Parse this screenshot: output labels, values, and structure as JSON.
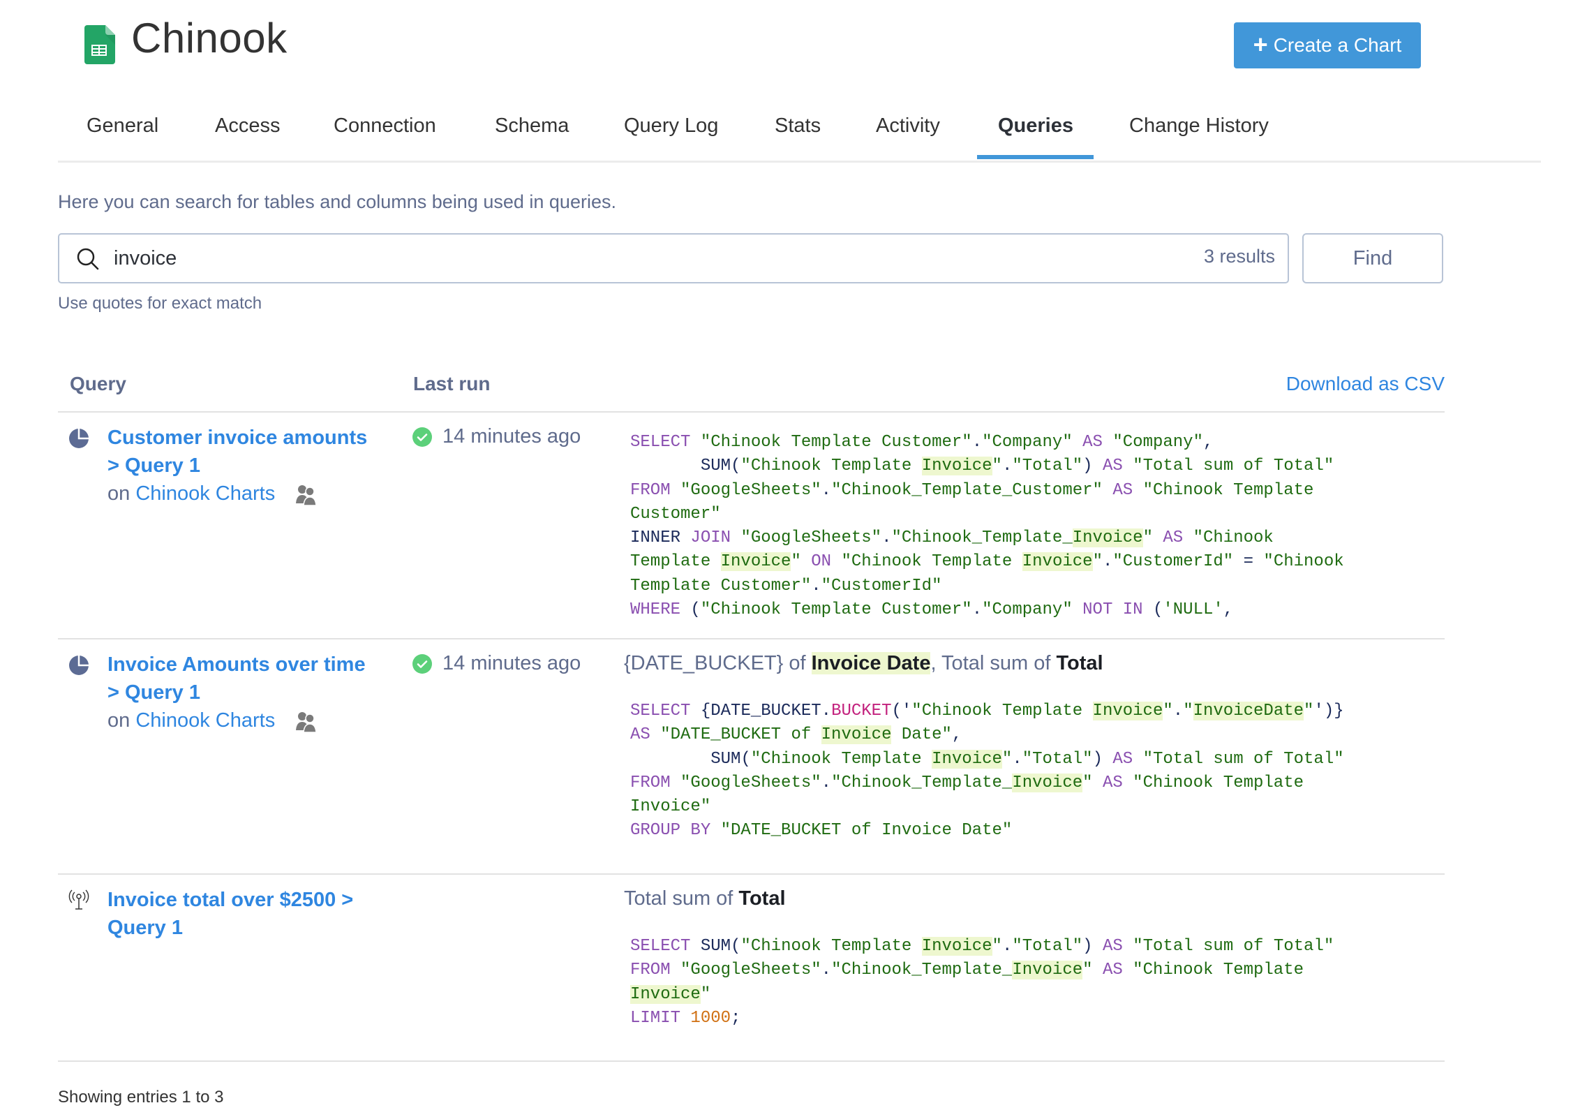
{
  "header": {
    "title": "Chinook",
    "logo_icon": "google-sheets-icon",
    "create_button_label": "Create a Chart",
    "create_button_icon": "plus-icon",
    "accent_color": "#4197d9"
  },
  "tabs": [
    {
      "label": "General",
      "active": false
    },
    {
      "label": "Access",
      "active": false
    },
    {
      "label": "Connection",
      "active": false
    },
    {
      "label": "Schema",
      "active": false
    },
    {
      "label": "Query Log",
      "active": false
    },
    {
      "label": "Stats",
      "active": false
    },
    {
      "label": "Activity",
      "active": false
    },
    {
      "label": "Queries",
      "active": true
    },
    {
      "label": "Change History",
      "active": false
    }
  ],
  "search": {
    "description": "Here you can search for tables and columns being used in queries.",
    "value": "invoice",
    "result_count": "3 results",
    "find_label": "Find",
    "hint": "Use quotes for exact match"
  },
  "table": {
    "columns": [
      "Query",
      "Last run"
    ],
    "download_label": "Download as CSV",
    "rows": [
      {
        "icon": "pie-chart-icon",
        "name_line1": "Customer invoice amounts",
        "name_line2": "> Query 1",
        "on_label": "on",
        "dashboard": "Chinook Charts",
        "shared_icon": "people-icon",
        "last_run": "14 minutes ago",
        "status": "success",
        "summary": null,
        "sql": [
          [
            [
              "kw",
              "SELECT"
            ],
            [
              "t",
              " "
            ],
            [
              "st",
              "\"Chinook Template Customer\""
            ],
            [
              "t",
              "."
            ],
            [
              "st",
              "\"Company\""
            ],
            [
              "t",
              " "
            ],
            [
              "kw",
              "AS"
            ],
            [
              "t",
              " "
            ],
            [
              "st",
              "\"Company\""
            ],
            [
              "t",
              ","
            ]
          ],
          [
            [
              "t",
              "       "
            ],
            [
              "fn",
              "SUM"
            ],
            [
              "t",
              "("
            ],
            [
              "st",
              "\"Chinook Template "
            ],
            [
              "sth",
              "Invoice"
            ],
            [
              "st",
              "\""
            ],
            [
              "t",
              "."
            ],
            [
              "st",
              "\"Total\""
            ],
            [
              "t",
              ") "
            ],
            [
              "kw",
              "AS"
            ],
            [
              "t",
              " "
            ],
            [
              "st",
              "\"Total sum of Total\""
            ]
          ],
          [
            [
              "kw",
              "FROM"
            ],
            [
              "t",
              " "
            ],
            [
              "st",
              "\"GoogleSheets\""
            ],
            [
              "t",
              "."
            ],
            [
              "st",
              "\"Chinook_Template_Customer\""
            ],
            [
              "t",
              " "
            ],
            [
              "kw",
              "AS"
            ],
            [
              "t",
              " "
            ],
            [
              "st",
              "\"Chinook Template"
            ]
          ],
          [
            [
              "st",
              "Customer\""
            ]
          ],
          [
            [
              "fn",
              "INNER"
            ],
            [
              "t",
              " "
            ],
            [
              "kw",
              "JOIN"
            ],
            [
              "t",
              " "
            ],
            [
              "st",
              "\"GoogleSheets\""
            ],
            [
              "t",
              "."
            ],
            [
              "st",
              "\"Chinook_Template_"
            ],
            [
              "sth",
              "Invoice"
            ],
            [
              "st",
              "\""
            ],
            [
              "t",
              " "
            ],
            [
              "kw",
              "AS"
            ],
            [
              "t",
              " "
            ],
            [
              "st",
              "\"Chinook"
            ]
          ],
          [
            [
              "st",
              "Template "
            ],
            [
              "sth",
              "Invoice"
            ],
            [
              "st",
              "\""
            ],
            [
              "t",
              " "
            ],
            [
              "kw",
              "ON"
            ],
            [
              "t",
              " "
            ],
            [
              "st",
              "\"Chinook Template "
            ],
            [
              "sth",
              "Invoice"
            ],
            [
              "st",
              "\""
            ],
            [
              "t",
              "."
            ],
            [
              "st",
              "\"CustomerId\""
            ],
            [
              "t",
              " = "
            ],
            [
              "st",
              "\"Chinook"
            ]
          ],
          [
            [
              "st",
              "Template Customer\""
            ],
            [
              "t",
              "."
            ],
            [
              "st",
              "\"CustomerId\""
            ]
          ],
          [
            [
              "kw",
              "WHERE"
            ],
            [
              "t",
              " ("
            ],
            [
              "st",
              "\"Chinook Template Customer\""
            ],
            [
              "t",
              "."
            ],
            [
              "st",
              "\"Company\""
            ],
            [
              "t",
              " "
            ],
            [
              "kw",
              "NOT IN"
            ],
            [
              "t",
              " ("
            ],
            [
              "st",
              "'NULL'"
            ],
            [
              "t",
              ","
            ]
          ]
        ]
      },
      {
        "icon": "pie-chart-icon",
        "name_line1": "Invoice Amounts over time",
        "name_line2": "> Query 1",
        "on_label": "on",
        "dashboard": "Chinook Charts",
        "shared_icon": "people-icon",
        "last_run": "14 minutes ago",
        "status": "success",
        "summary": {
          "prefix": "{DATE_BUCKET} of ",
          "field1": "Invoice Date",
          "middle": ", Total sum of ",
          "field2": "Total"
        },
        "sql": [
          [
            [
              "kw",
              "SELECT"
            ],
            [
              "t",
              " "
            ],
            [
              "fn",
              "{DATE_BUCKET"
            ],
            [
              "t",
              "."
            ],
            [
              "fn2",
              "BUCKET"
            ],
            [
              "t",
              "('"
            ],
            [
              "st",
              "\"Chinook Template "
            ],
            [
              "sth",
              "Invoice"
            ],
            [
              "st",
              "\""
            ],
            [
              "t",
              "."
            ],
            [
              "st",
              "\""
            ],
            [
              "sth",
              "InvoiceDate"
            ],
            [
              "st",
              "\""
            ],
            [
              "t",
              "')}"
            ]
          ],
          [
            [
              "kw",
              "AS"
            ],
            [
              "t",
              " "
            ],
            [
              "st",
              "\"DATE_BUCKET of "
            ],
            [
              "sth",
              "Invoice"
            ],
            [
              "st",
              " Date\""
            ],
            [
              "t",
              ","
            ]
          ],
          [
            [
              "t",
              "        "
            ],
            [
              "fn",
              "SUM"
            ],
            [
              "t",
              "("
            ],
            [
              "st",
              "\"Chinook Template "
            ],
            [
              "sth",
              "Invoice"
            ],
            [
              "st",
              "\""
            ],
            [
              "t",
              "."
            ],
            [
              "st",
              "\"Total\""
            ],
            [
              "t",
              ") "
            ],
            [
              "kw",
              "AS"
            ],
            [
              "t",
              " "
            ],
            [
              "st",
              "\"Total sum of Total\""
            ]
          ],
          [
            [
              "kw",
              "FROM"
            ],
            [
              "t",
              " "
            ],
            [
              "st",
              "\"GoogleSheets\""
            ],
            [
              "t",
              "."
            ],
            [
              "st",
              "\"Chinook_Template_"
            ],
            [
              "sth",
              "Invoice"
            ],
            [
              "st",
              "\""
            ],
            [
              "t",
              " "
            ],
            [
              "kw",
              "AS"
            ],
            [
              "t",
              " "
            ],
            [
              "st",
              "\"Chinook Template"
            ]
          ],
          [
            [
              "st",
              "Invoice\""
            ]
          ],
          [
            [
              "kw",
              "GROUP BY"
            ],
            [
              "t",
              " "
            ],
            [
              "st",
              "\"DATE_BUCKET of Invoice Date\""
            ]
          ]
        ]
      },
      {
        "icon": "broadcast-icon",
        "name_line1": "Invoice total over $2500 >",
        "name_line2": "Query 1",
        "on_label": null,
        "dashboard": null,
        "shared_icon": null,
        "last_run": null,
        "status": null,
        "summary": {
          "prefix": "Total sum of ",
          "field1": null,
          "middle": "",
          "field2": "Total"
        },
        "sql": [
          [
            [
              "kw",
              "SELECT"
            ],
            [
              "t",
              " "
            ],
            [
              "fn",
              "SUM"
            ],
            [
              "t",
              "("
            ],
            [
              "st",
              "\"Chinook Template "
            ],
            [
              "sth",
              "Invoice"
            ],
            [
              "st",
              "\""
            ],
            [
              "t",
              "."
            ],
            [
              "st",
              "\"Total\""
            ],
            [
              "t",
              ") "
            ],
            [
              "kw",
              "AS"
            ],
            [
              "t",
              " "
            ],
            [
              "st",
              "\"Total sum of Total\""
            ]
          ],
          [
            [
              "kw",
              "FROM"
            ],
            [
              "t",
              " "
            ],
            [
              "st",
              "\"GoogleSheets\""
            ],
            [
              "t",
              "."
            ],
            [
              "st",
              "\"Chinook_Template_"
            ],
            [
              "sth",
              "Invoice"
            ],
            [
              "st",
              "\""
            ],
            [
              "t",
              " "
            ],
            [
              "kw",
              "AS"
            ],
            [
              "t",
              " "
            ],
            [
              "st",
              "\"Chinook Template"
            ]
          ],
          [
            [
              "sth",
              "Invoice"
            ],
            [
              "st",
              "\""
            ]
          ],
          [
            [
              "kw",
              "LIMIT"
            ],
            [
              "t",
              " "
            ],
            [
              "num",
              "1000"
            ],
            [
              "t",
              ";"
            ]
          ]
        ]
      }
    ]
  },
  "footer": {
    "entries_text": "Showing entries 1 to 3"
  }
}
